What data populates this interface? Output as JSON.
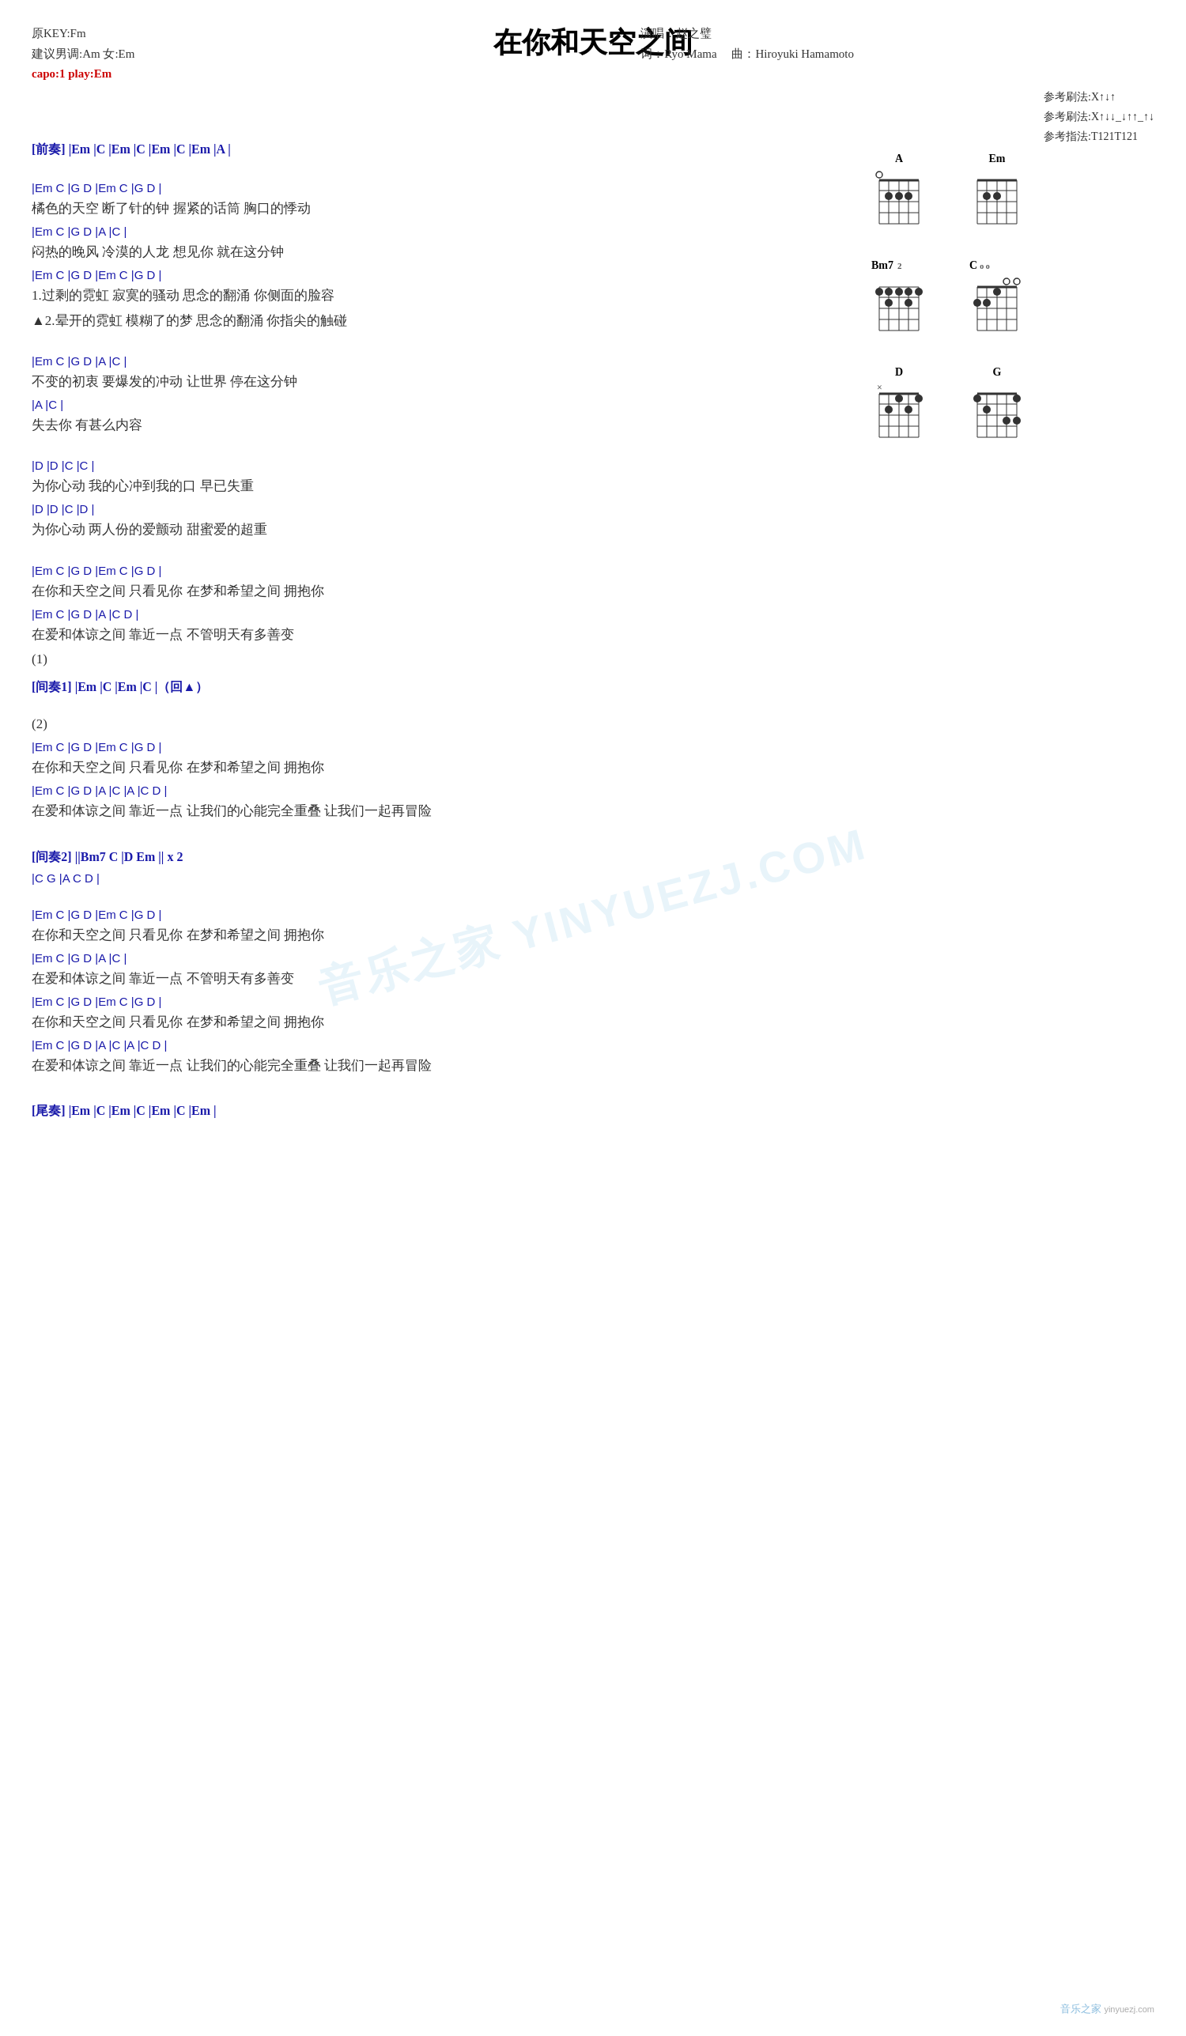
{
  "song": {
    "title": "在你和天空之间",
    "artist": "演唱：赵之璧",
    "lyricist": "词：Ryo Mama",
    "composer": "曲：Hiroyuki Hamamoto",
    "key": "原KEY:Fm",
    "suggest": "建议男调:Am 女:Em",
    "capo": "capo:1 play:Em"
  },
  "strum": {
    "line1": "参考刷法:X↑↓↑",
    "line2": "参考刷法:X↑↓↓_↓↑↑_↑↓",
    "line3": "参考指法:T121T121"
  },
  "chords": {
    "A": {
      "name": "A",
      "fret": 0
    },
    "Em": {
      "name": "Em",
      "fret": 0
    },
    "Bm7": {
      "name": "Bm7",
      "fret": 2
    },
    "C": {
      "name": "C",
      "fret": 0
    },
    "D": {
      "name": "D",
      "fret": 0
    },
    "G": {
      "name": "G",
      "fret": 0
    }
  },
  "sections": [
    {
      "type": "label",
      "text": "[前奏] |Em  |C  |Em  |C  |Em  |C  |Em  |A  |"
    },
    {
      "type": "spacer"
    },
    {
      "type": "chord",
      "text": "  |Em   C    |G    D       |Em   C    |G    D   |"
    },
    {
      "type": "lyric",
      "text": "橘色的天空   断了针的钟    握紧的话筒    胸口的悸动"
    },
    {
      "type": "chord",
      "text": "  |Em   C    |G    D       |A          |C        |"
    },
    {
      "type": "lyric",
      "text": "闷热的晚风   冷漠的人龙    想见你    就在这分钟"
    },
    {
      "type": "chord",
      "text": "  |Em   C    |G    D       |Em   C    |G    D   |"
    },
    {
      "type": "lyric",
      "text": "1.过剩的霓虹   寂寞的骚动    思念的翻涌    你侧面的脸容"
    },
    {
      "type": "lyric",
      "text": "▲2.晕开的霓虹   模糊了的梦    思念的翻涌    你指尖的触碰"
    },
    {
      "type": "spacer"
    },
    {
      "type": "chord",
      "text": "  |Em   C    |G    D       |A          |C        |"
    },
    {
      "type": "lyric",
      "text": "不变的初衷    要爆发的冲动    让世界    停在这分钟"
    },
    {
      "type": "chord",
      "text": "         |A          |C        |"
    },
    {
      "type": "lyric",
      "text": "失去你    有甚么内容"
    },
    {
      "type": "spacer"
    },
    {
      "type": "chord",
      "text": "  |D            |D              |C      |C       |"
    },
    {
      "type": "lyric",
      "text": "为你心动   我的心冲到我的口    早已失重"
    },
    {
      "type": "chord",
      "text": "  |D            |D              |C      |D       |"
    },
    {
      "type": "lyric",
      "text": "为你心动   两人份的爱颤动    甜蜜爱的超重"
    },
    {
      "type": "spacer"
    },
    {
      "type": "chord",
      "text": "  |Em   C    |G    D       |Em   C    |G    D   |"
    },
    {
      "type": "lyric",
      "text": "在你和天空之间   只看见你    在梦和希望之间    拥抱你"
    },
    {
      "type": "chord",
      "text": "  |Em   C    |G    D       |A          |C    D   |"
    },
    {
      "type": "lyric",
      "text": "在爱和体谅之间    靠近一点    不管明天有多善变"
    },
    {
      "type": "lyric",
      "text": "(1)"
    },
    {
      "type": "label",
      "text": "[间奏1] |Em  |C  |Em  |C  |（回▲）"
    },
    {
      "type": "spacer"
    },
    {
      "type": "lyric",
      "text": "(2)"
    },
    {
      "type": "chord",
      "text": "  |Em   C    |G    D       |Em   C    |G    D   |"
    },
    {
      "type": "lyric",
      "text": "在你和天空之间   只看见你    在梦和希望之间    拥抱你"
    },
    {
      "type": "chord",
      "text": "  |Em   C    |G    D       |A          |C        |A          |C    D   |"
    },
    {
      "type": "lyric",
      "text": "在爱和体谅之间    靠近一点    让我们的心能完全重叠    让我们一起再冒险"
    },
    {
      "type": "spacer"
    },
    {
      "type": "label",
      "text": "[间奏2] ||Bm7  C  |D  Em  || x 2"
    },
    {
      "type": "chord",
      "text": "         |C    G  |A  C  D  |"
    },
    {
      "type": "spacer"
    },
    {
      "type": "chord",
      "text": "  |Em   C    |G    D       |Em   C    |G    D   |"
    },
    {
      "type": "lyric",
      "text": "在你和天空之间   只看见你    在梦和希望之间    拥抱你"
    },
    {
      "type": "chord",
      "text": "  |Em   C    |G    D       |A          |C        |"
    },
    {
      "type": "lyric",
      "text": "在爱和体谅之间    靠近一点    不管明天有多善变"
    },
    {
      "type": "chord",
      "text": "  |Em   C    |G    D       |Em   C    |G    D   |"
    },
    {
      "type": "lyric",
      "text": "在你和天空之间   只看见你    在梦和希望之间    拥抱你"
    },
    {
      "type": "chord",
      "text": "  |Em   C    |G    D       |A          |C        |A          |C    D   |"
    },
    {
      "type": "lyric",
      "text": "在爱和体谅之间    靠近一点    让我们的心能完全重叠    让我们一起再冒险"
    },
    {
      "type": "spacer"
    },
    {
      "type": "label",
      "text": "[尾奏] |Em  |C  |Em  |C  |Em  |C  |Em  |"
    }
  ],
  "watermark": "音乐之家 YINYUEZJ.COM",
  "website": "yinyuezj.com"
}
